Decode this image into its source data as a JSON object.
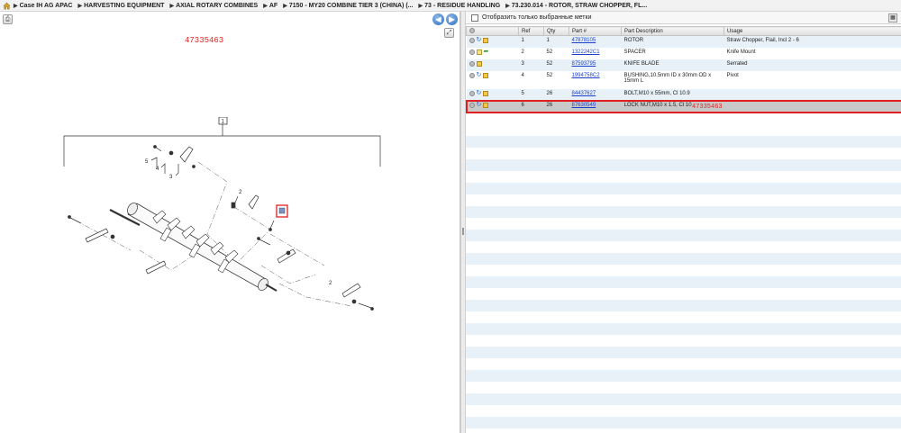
{
  "breadcrumb": {
    "items": [
      "Case IH AG APAC",
      "HARVESTING EQUIPMENT",
      "AXIAL ROTARY COMBINES",
      "AF",
      "7150 - MY20 COMBINE TIER 3 (CHINA) (...",
      "73 - RESIDUE HANDLING",
      "73.230.014 - ROTOR, STRAW CHOPPER, FL..."
    ]
  },
  "drawing": {
    "annotation": "47335463",
    "callouts": [
      "1",
      "2",
      "2",
      "3",
      "4",
      "5",
      "6"
    ]
  },
  "parts_panel": {
    "filter_label": "Отобразить только выбранные метки",
    "columns": [
      "Ref",
      "Qty",
      "Part #",
      "Part Description",
      "Usage"
    ],
    "rows": [
      {
        "ref": "1",
        "qty": "1",
        "part": "47878105",
        "desc": "ROTOR",
        "usage": "Straw Chopper, Flail, Incl 2 - 6"
      },
      {
        "ref": "2",
        "qty": "52",
        "part": "1322242C1",
        "desc": "SPACER",
        "usage": "Knife Mount"
      },
      {
        "ref": "3",
        "qty": "52",
        "part": "87593795",
        "desc": "KNIFE BLADE",
        "usage": "Serrated"
      },
      {
        "ref": "4",
        "qty": "52",
        "part": "1994758C2",
        "desc": "BUSHING,10.5mm ID x 30mm OD x 15mm L",
        "usage": "Pivot"
      },
      {
        "ref": "5",
        "qty": "26",
        "part": "84437627",
        "desc": "BOLT,M10 x 55mm, Cl 10.9",
        "usage": ""
      },
      {
        "ref": "6",
        "qty": "26",
        "part": "87630549",
        "desc": "LOCK NUT,M10 x 1.5, Cl 10",
        "usage": ""
      }
    ],
    "selected_annotation": "47335463"
  },
  "colors": {
    "highlight": "#e02020",
    "link": "#1a3fcc",
    "row_alt": "#e8f0f8",
    "selected_row": "#c9c9c9"
  }
}
